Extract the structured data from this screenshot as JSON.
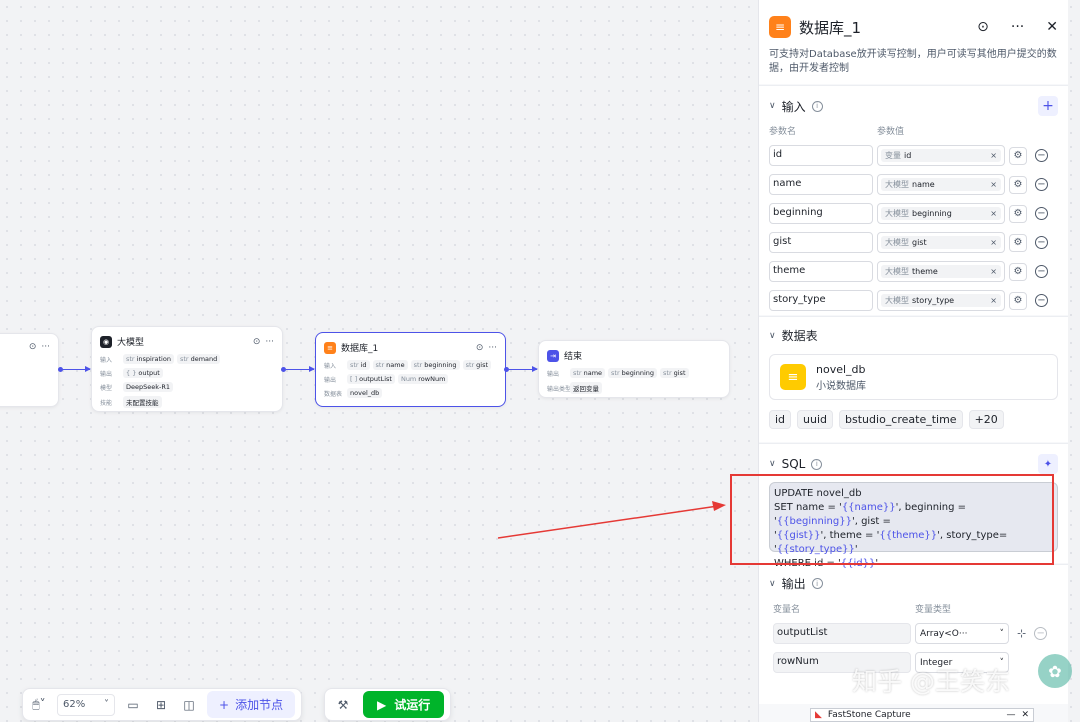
{
  "canvas": {
    "node_start": {
      "actions": [
        "⊙",
        "···"
      ]
    },
    "node_llm": {
      "title": "大模型",
      "rows": [
        {
          "k": "输入",
          "tags": [
            {
              "pre": "str",
              "name": "inspiration"
            },
            {
              "pre": "str",
              "name": "demand"
            }
          ]
        },
        {
          "k": "输出",
          "tags": [
            {
              "pre": "{ }",
              "name": "output"
            }
          ]
        },
        {
          "k": "模型",
          "tags": [
            {
              "pre": "",
              "name": "DeepSeek-R1"
            }
          ]
        },
        {
          "k": "技能",
          "tags": [
            {
              "pre": "",
              "name": "未配置技能"
            }
          ]
        }
      ]
    },
    "node_db": {
      "title": "数据库_1",
      "rows": [
        {
          "k": "输入",
          "tags": [
            {
              "pre": "str",
              "name": "id"
            },
            {
              "pre": "str",
              "name": "name"
            },
            {
              "pre": "str",
              "name": "beginning"
            },
            {
              "pre": "str",
              "name": "gist"
            }
          ]
        },
        {
          "k": "输出",
          "tags": [
            {
              "pre": "[ ]",
              "name": "outputList"
            },
            {
              "pre": "Num",
              "name": "rowNum"
            }
          ]
        },
        {
          "k": "数据表",
          "tags": [
            {
              "pre": "",
              "name": "novel_db"
            }
          ]
        }
      ]
    },
    "node_end": {
      "title": "结束",
      "rows": [
        {
          "k": "输出",
          "tags": [
            {
              "pre": "str",
              "name": "name"
            },
            {
              "pre": "str",
              "name": "beginning"
            },
            {
              "pre": "str",
              "name": "gist"
            }
          ]
        },
        {
          "k": "输出类型",
          "tags": [
            {
              "pre": "",
              "name": "返回变量"
            }
          ]
        }
      ]
    }
  },
  "toolbar": {
    "zoom": "62%",
    "add_node_label": "添加节点",
    "run_label": "试运行"
  },
  "panel": {
    "title": "数据库_1",
    "description": "可支持对Database放开读写控制，用户可读写其他用户提交的数据，由开发者控制",
    "input_section": {
      "title": "输入",
      "col_name": "参数名",
      "col_value": "参数值",
      "params": [
        {
          "name": "id",
          "source": "变量",
          "value": "id"
        },
        {
          "name": "name",
          "source": "大模型",
          "value": "name"
        },
        {
          "name": "beginning",
          "source": "大模型",
          "value": "beginning"
        },
        {
          "name": "gist",
          "source": "大模型",
          "value": "gist"
        },
        {
          "name": "theme",
          "source": "大模型",
          "value": "theme"
        },
        {
          "name": "story_type",
          "source": "大模型",
          "value": "story_type"
        }
      ]
    },
    "table_section": {
      "title": "数据表",
      "db_name": "novel_db",
      "db_desc": "小说数据库",
      "fields": [
        "id",
        "uuid",
        "bstudio_create_time",
        "+20"
      ]
    },
    "sql_section": {
      "title": "SQL",
      "lines": [
        [
          {
            "t": "UPDATE novel_db"
          }
        ],
        [
          {
            "t": "SET name = '"
          },
          {
            "t": "{{name}}",
            "v": true
          },
          {
            "t": "', beginning = '"
          },
          {
            "t": "{{beginning}}",
            "v": true
          },
          {
            "t": "', gist ="
          }
        ],
        [
          {
            "t": "'"
          },
          {
            "t": "{{gist}}",
            "v": true
          },
          {
            "t": "', theme = '"
          },
          {
            "t": "{{theme}}",
            "v": true
          },
          {
            "t": "', story_type= '"
          },
          {
            "t": "{{story_type}}",
            "v": true
          },
          {
            "t": "'"
          }
        ],
        [
          {
            "t": "WHERE  id = '"
          },
          {
            "t": "{{id}}",
            "v": true
          },
          {
            "t": "'"
          }
        ]
      ]
    },
    "output_section": {
      "title": "输出",
      "col_name": "变量名",
      "col_type": "变量类型",
      "outputs": [
        {
          "name": "outputList",
          "type": "Array<O···"
        },
        {
          "name": "rowNum",
          "type": "Integer"
        }
      ]
    }
  },
  "overlay": {
    "faststone_title": "FastStone Capture",
    "watermark": "知乎 @王笑东"
  },
  "colors": {
    "accent": "#4d53e8",
    "run": "#00b42a",
    "db": "#ff811a",
    "annotation": "#e53935"
  }
}
